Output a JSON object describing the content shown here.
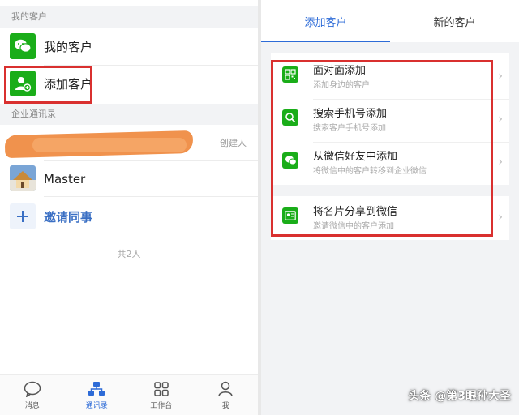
{
  "left": {
    "my_customers_section": "我的客户",
    "my_customers_label": "我的客户",
    "add_customer_label": "添加客户",
    "corp_section": "企业通讯录",
    "creator_tag": "创建人",
    "master_name": "Master",
    "invite_label": "邀请同事",
    "total_count": "共2人"
  },
  "tabbar": {
    "items": [
      {
        "label": "消息",
        "icon": "chat-bubble-icon"
      },
      {
        "label": "通讯录",
        "icon": "contacts-org-icon"
      },
      {
        "label": "工作台",
        "icon": "grid-apps-icon"
      },
      {
        "label": "我",
        "icon": "person-icon"
      }
    ],
    "active_index": 1
  },
  "right": {
    "tabs": [
      "添加客户",
      "新的客户"
    ],
    "items": [
      {
        "title": "面对面添加",
        "sub": "添加身边的客户",
        "icon": "qr-code-icon"
      },
      {
        "title": "搜索手机号添加",
        "sub": "搜索客户手机号添加",
        "icon": "search-icon"
      },
      {
        "title": "从微信好友中添加",
        "sub": "将微信中的客户转移到企业微信",
        "icon": "wechat-icon"
      },
      {
        "title": "将名片分享到微信",
        "sub": "邀请微信中的客户添加",
        "icon": "business-card-icon"
      }
    ]
  },
  "watermark": "头条 @第3眼孙大圣",
  "colors": {
    "accent": "#2d6bd7",
    "green": "#1aad19",
    "highlight": "#d9302f"
  }
}
